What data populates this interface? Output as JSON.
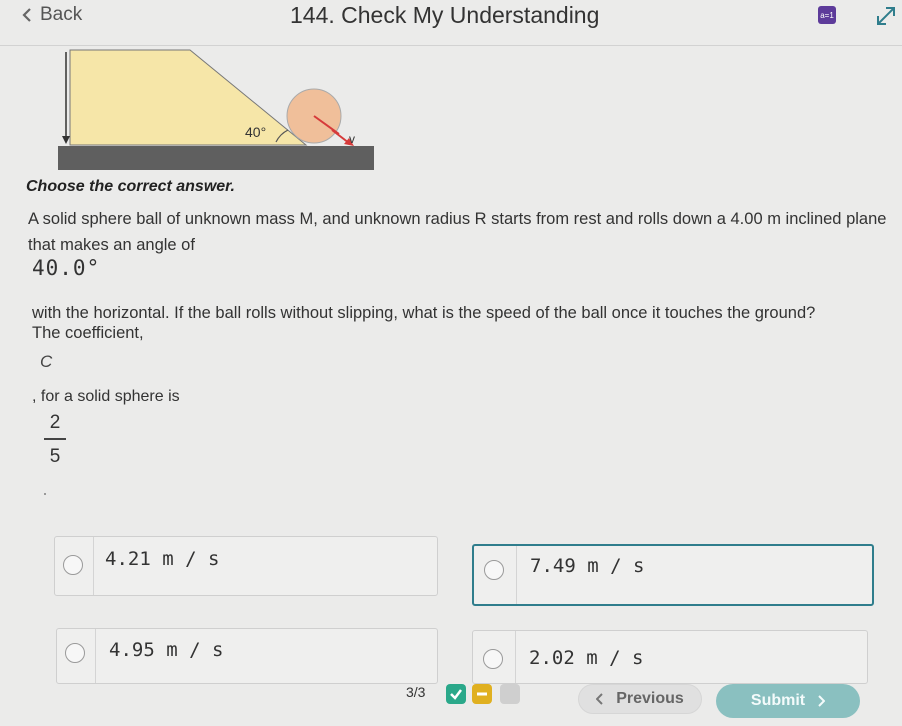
{
  "header": {
    "back_label": "Back",
    "title": "144. Check My Understanding",
    "calculator_label": "a=1"
  },
  "figure": {
    "angle_label": "40°",
    "velocity_label": "v"
  },
  "question": {
    "instruction": "Choose the correct answer.",
    "text_part1": "A solid sphere ball of unknown mass M, and unknown radius R starts from rest and rolls down a 4.00 m inclined plane that makes an angle of",
    "angle_value": "40.0°",
    "text_part2": "with the horizontal. If the ball rolls without slipping, what is the speed of the ball once it touches the ground?",
    "text_part3": "The coefficient,",
    "coef_variable": "C",
    "text_part4": ", for a solid sphere is",
    "fraction_numerator": "2",
    "fraction_denominator": "5"
  },
  "options": [
    {
      "value": "4.21 m / s"
    },
    {
      "value": "7.49 m / s"
    },
    {
      "value": "4.95 m / s"
    },
    {
      "value": "2.02 m / s"
    }
  ],
  "footer": {
    "progress": "3/3",
    "previous_label": "Previous",
    "submit_label": "Submit"
  },
  "colors": {
    "accent": "#2f7d8c",
    "submit_bg": "#8ac0c0",
    "check_green": "#2aa88a",
    "minus_yellow": "#e0b020",
    "calculator_purple": "#5d3b9a",
    "incline_fill": "#f6e6a8",
    "ball_fill": "#f0bf9a"
  }
}
